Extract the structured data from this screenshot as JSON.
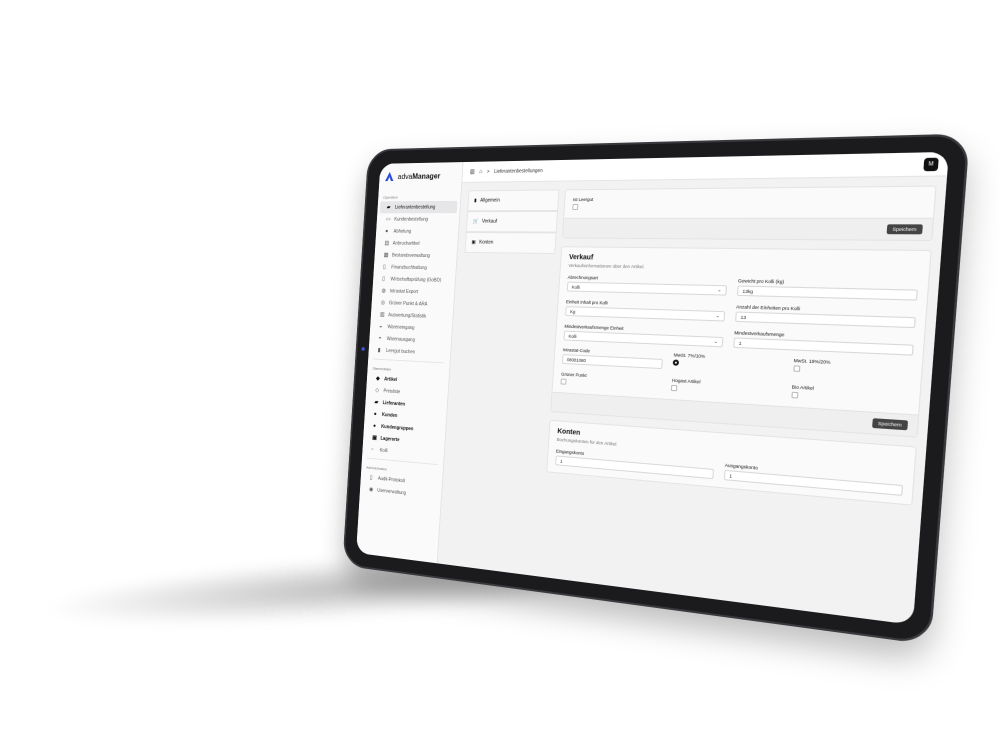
{
  "app": {
    "name_prefix": "adva",
    "name_suffix": "Manager"
  },
  "colors": {
    "accent": "#2b4bd6",
    "active_bg": "#e6e6e8",
    "button": "#444444"
  },
  "header": {
    "breadcrumb_icon": "sidebar-toggle-icon",
    "home_icon": "home-icon",
    "breadcrumb_sep": ">",
    "breadcrumb_current": "Lieferantenbestellungen",
    "avatar_initial": "M"
  },
  "sidebar": {
    "sections": [
      {
        "title": "Operation",
        "items": [
          {
            "label": "Lieferantenbestellung",
            "icon": "truck-icon",
            "active": true
          },
          {
            "label": "Kundenbestellung",
            "icon": "cart-icon"
          },
          {
            "label": "Abholung",
            "icon": "person-icon"
          },
          {
            "label": "Anbruchartikel",
            "icon": "box-icon"
          },
          {
            "label": "Bestandsverwaltung",
            "icon": "stack-icon"
          },
          {
            "label": "Finanzbuchhaltung",
            "icon": "document-icon"
          },
          {
            "label": "Wirtschaftsprüfung (GoBD)",
            "icon": "document-icon"
          },
          {
            "label": "Intrastat Export",
            "icon": "globe-icon"
          },
          {
            "label": "Grüner Punkt & ARA",
            "icon": "recycle-icon"
          },
          {
            "label": "Auswertung/Statistik",
            "icon": "chart-icon"
          },
          {
            "label": "Wareneingang",
            "icon": "download-icon"
          },
          {
            "label": "Warenausgang",
            "icon": "upload-icon"
          },
          {
            "label": "Leergut buchen",
            "icon": "bottle-icon"
          }
        ]
      },
      {
        "title": "Stammdaten",
        "items": [
          {
            "label": "Artikel",
            "icon": "tag-icon",
            "bold": true
          },
          {
            "label": "Preisliste",
            "icon": "pricetag-icon"
          },
          {
            "label": "Lieferanten",
            "icon": "truck-icon",
            "bold": true
          },
          {
            "label": "Kunden",
            "icon": "person-icon",
            "bold": true
          },
          {
            "label": "Kundengruppen",
            "icon": "group-icon",
            "bold": true
          },
          {
            "label": "Lagerorte",
            "icon": "warehouse-icon",
            "bold": true
          },
          {
            "label": "Kolli",
            "icon": "package-icon"
          }
        ]
      },
      {
        "title": "Administration",
        "items": [
          {
            "label": "Audit-Protokoll",
            "icon": "document-icon"
          },
          {
            "label": "Userverwaltung",
            "icon": "users-icon"
          }
        ]
      }
    ]
  },
  "tabs": [
    {
      "label": "Allgemein",
      "icon": "file-icon"
    },
    {
      "label": "Verkauf",
      "icon": "cart-icon"
    },
    {
      "label": "Konten",
      "icon": "wallet-icon"
    }
  ],
  "leergut_card": {
    "checkbox_label": "Ist Leergut",
    "save_label": "Speichern"
  },
  "verkauf_card": {
    "title": "Verkauf",
    "subtitle": "Verkaufsinformationen über den Artikel.",
    "fields": {
      "abrechnungsart_label": "Abrechnungsart",
      "abrechnungsart_value": "Kolli",
      "gewicht_label": "Gewicht pro Kolli (kg)",
      "gewicht_value": "13kg",
      "einheit_inhalt_label": "Einheit Inhalt pro Kolli",
      "einheit_inhalt_value": "Kg",
      "anzahl_einheiten_label": "Anzahl der Einheiten pro Kolli",
      "anzahl_einheiten_value": "13",
      "mindest_einheit_label": "Mindestverkaufsmenge Einheit",
      "mindest_einheit_value": "Kolli",
      "mindestmenge_label": "Mindestverkaufsmenge",
      "mindestmenge_value": "1",
      "intrastat_label": "Intrastat-Code",
      "intrastat_value": "08081080",
      "mwst1_label": "MwSt. 7%/10%",
      "mwst2_label": "MwSt. 19%/20%",
      "gruener_punkt_label": "Grüner Punkt",
      "hogast_label": "Hogast Artikel",
      "bio_label": "Bio Artikel"
    },
    "save_label": "Speichern"
  },
  "konten_card": {
    "title": "Konten",
    "subtitle": "Buchungskonten für den Artikel.",
    "eingang_label": "Eingangskonto",
    "eingang_value": "1",
    "ausgang_label": "Ausgangskonto",
    "ausgang_value": "1"
  }
}
